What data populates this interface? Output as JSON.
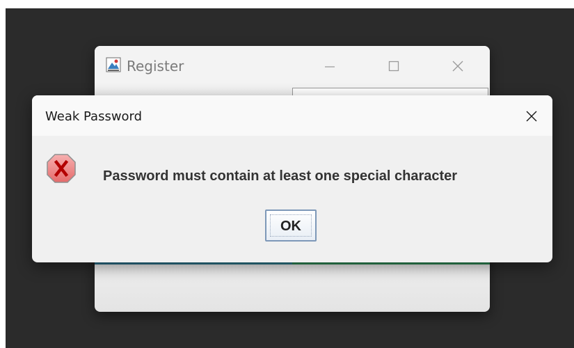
{
  "background_window": {
    "title": "Register"
  },
  "dialog": {
    "title": "Weak Password",
    "message": "Password must contain at least one special character",
    "ok_label": "OK",
    "icon": "error-x-icon"
  },
  "colors": {
    "desktop": "#2b2b2b",
    "dialog_bg": "#f0f0f0",
    "error_icon_fill": "#f08a8a",
    "error_icon_x": "#b30000",
    "button_border": "#7d98b8"
  }
}
